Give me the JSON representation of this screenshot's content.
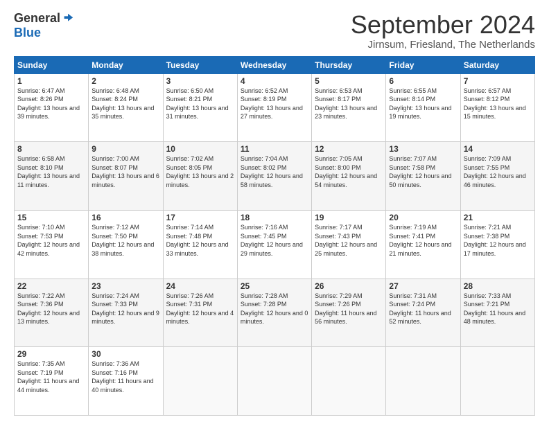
{
  "logo": {
    "general": "General",
    "blue": "Blue"
  },
  "title": "September 2024",
  "subtitle": "Jirnsum, Friesland, The Netherlands",
  "days_header": [
    "Sunday",
    "Monday",
    "Tuesday",
    "Wednesday",
    "Thursday",
    "Friday",
    "Saturday"
  ],
  "weeks": [
    [
      {
        "num": "1",
        "sunrise": "6:47 AM",
        "sunset": "8:26 PM",
        "daylight": "13 hours and 39 minutes."
      },
      {
        "num": "2",
        "sunrise": "6:48 AM",
        "sunset": "8:24 PM",
        "daylight": "13 hours and 35 minutes."
      },
      {
        "num": "3",
        "sunrise": "6:50 AM",
        "sunset": "8:21 PM",
        "daylight": "13 hours and 31 minutes."
      },
      {
        "num": "4",
        "sunrise": "6:52 AM",
        "sunset": "8:19 PM",
        "daylight": "13 hours and 27 minutes."
      },
      {
        "num": "5",
        "sunrise": "6:53 AM",
        "sunset": "8:17 PM",
        "daylight": "13 hours and 23 minutes."
      },
      {
        "num": "6",
        "sunrise": "6:55 AM",
        "sunset": "8:14 PM",
        "daylight": "13 hours and 19 minutes."
      },
      {
        "num": "7",
        "sunrise": "6:57 AM",
        "sunset": "8:12 PM",
        "daylight": "13 hours and 15 minutes."
      }
    ],
    [
      {
        "num": "8",
        "sunrise": "6:58 AM",
        "sunset": "8:10 PM",
        "daylight": "13 hours and 11 minutes."
      },
      {
        "num": "9",
        "sunrise": "7:00 AM",
        "sunset": "8:07 PM",
        "daylight": "13 hours and 6 minutes."
      },
      {
        "num": "10",
        "sunrise": "7:02 AM",
        "sunset": "8:05 PM",
        "daylight": "13 hours and 2 minutes."
      },
      {
        "num": "11",
        "sunrise": "7:04 AM",
        "sunset": "8:02 PM",
        "daylight": "12 hours and 58 minutes."
      },
      {
        "num": "12",
        "sunrise": "7:05 AM",
        "sunset": "8:00 PM",
        "daylight": "12 hours and 54 minutes."
      },
      {
        "num": "13",
        "sunrise": "7:07 AM",
        "sunset": "7:58 PM",
        "daylight": "12 hours and 50 minutes."
      },
      {
        "num": "14",
        "sunrise": "7:09 AM",
        "sunset": "7:55 PM",
        "daylight": "12 hours and 46 minutes."
      }
    ],
    [
      {
        "num": "15",
        "sunrise": "7:10 AM",
        "sunset": "7:53 PM",
        "daylight": "12 hours and 42 minutes."
      },
      {
        "num": "16",
        "sunrise": "7:12 AM",
        "sunset": "7:50 PM",
        "daylight": "12 hours and 38 minutes."
      },
      {
        "num": "17",
        "sunrise": "7:14 AM",
        "sunset": "7:48 PM",
        "daylight": "12 hours and 33 minutes."
      },
      {
        "num": "18",
        "sunrise": "7:16 AM",
        "sunset": "7:45 PM",
        "daylight": "12 hours and 29 minutes."
      },
      {
        "num": "19",
        "sunrise": "7:17 AM",
        "sunset": "7:43 PM",
        "daylight": "12 hours and 25 minutes."
      },
      {
        "num": "20",
        "sunrise": "7:19 AM",
        "sunset": "7:41 PM",
        "daylight": "12 hours and 21 minutes."
      },
      {
        "num": "21",
        "sunrise": "7:21 AM",
        "sunset": "7:38 PM",
        "daylight": "12 hours and 17 minutes."
      }
    ],
    [
      {
        "num": "22",
        "sunrise": "7:22 AM",
        "sunset": "7:36 PM",
        "daylight": "12 hours and 13 minutes."
      },
      {
        "num": "23",
        "sunrise": "7:24 AM",
        "sunset": "7:33 PM",
        "daylight": "12 hours and 9 minutes."
      },
      {
        "num": "24",
        "sunrise": "7:26 AM",
        "sunset": "7:31 PM",
        "daylight": "12 hours and 4 minutes."
      },
      {
        "num": "25",
        "sunrise": "7:28 AM",
        "sunset": "7:28 PM",
        "daylight": "12 hours and 0 minutes."
      },
      {
        "num": "26",
        "sunrise": "7:29 AM",
        "sunset": "7:26 PM",
        "daylight": "11 hours and 56 minutes."
      },
      {
        "num": "27",
        "sunrise": "7:31 AM",
        "sunset": "7:24 PM",
        "daylight": "11 hours and 52 minutes."
      },
      {
        "num": "28",
        "sunrise": "7:33 AM",
        "sunset": "7:21 PM",
        "daylight": "11 hours and 48 minutes."
      }
    ],
    [
      {
        "num": "29",
        "sunrise": "7:35 AM",
        "sunset": "7:19 PM",
        "daylight": "11 hours and 44 minutes."
      },
      {
        "num": "30",
        "sunrise": "7:36 AM",
        "sunset": "7:16 PM",
        "daylight": "11 hours and 40 minutes."
      },
      null,
      null,
      null,
      null,
      null
    ]
  ]
}
